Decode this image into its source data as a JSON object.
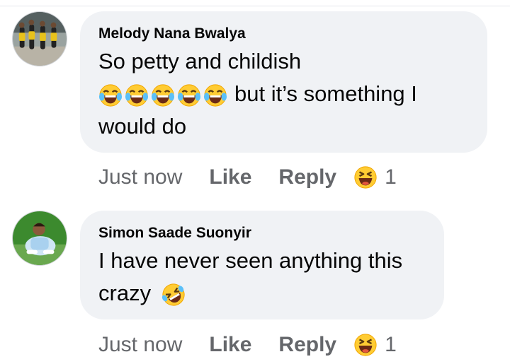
{
  "comments": [
    {
      "author": "Melody Nana Bwalya",
      "line1": "So petty and childish",
      "line2": "but it’s something I",
      "line3": "would do",
      "emoji_icons": [
        "tears-of-joy-emoji",
        "tears-of-joy-emoji",
        "tears-of-joy-emoji",
        "tears-of-joy-emoji",
        "tears-of-joy-emoji"
      ],
      "time": "Just now",
      "like_label": "Like",
      "reply_label": "Reply",
      "reaction_icon": "laughing-reaction",
      "reaction_count": "1"
    },
    {
      "author": "Simon Saade Suonyir",
      "line1": "I have never seen anything this",
      "line2": "crazy",
      "emoji_icons": [
        "rolling-on-floor-laughing-emoji"
      ],
      "time": "Just now",
      "like_label": "Like",
      "reply_label": "Reply",
      "reaction_icon": "laughing-reaction",
      "reaction_count": "1"
    }
  ],
  "colors": {
    "bubble": "#f0f2f5",
    "secondary_text": "#65676b",
    "emoji_face": "#ffcc33"
  }
}
